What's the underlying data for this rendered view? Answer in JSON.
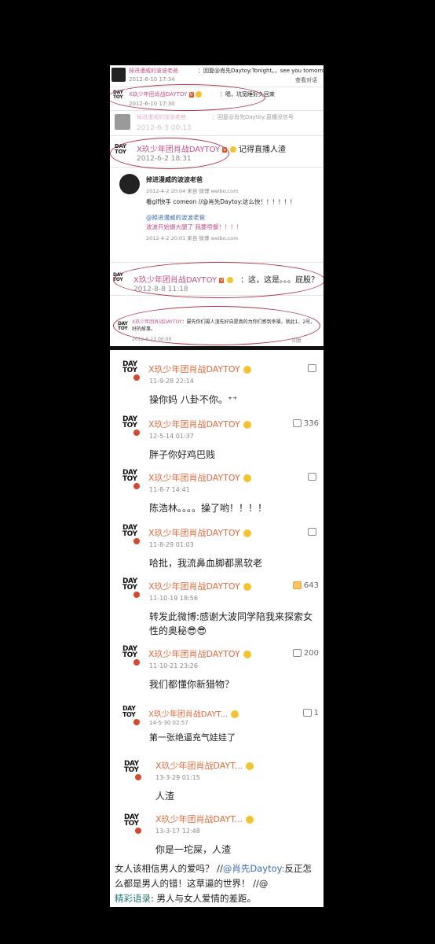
{
  "archive": {
    "rows": [
      {
        "name": "掉进漫威的波波老爸",
        "text": "：回复@肖先Daytoy:Tonight。，see you tomorrom",
        "time": "2012-6-10 17:34",
        "action": "查看对话"
      },
      {
        "name": "X玖少年团肖战DAYTOY",
        "text": "：嗯，坑宽睡好久回来",
        "time": "2012-6-10 17:30"
      },
      {
        "name": "掉进漫威的波波老爸",
        "text": "：回复@肖先Daytoy:直播没信号",
        "time": "2012-6-3 00:13"
      },
      {
        "name": "X玖少年团肖战DAYTOY",
        "text": "记得直播人渣",
        "time": "2012-6-2 18:31"
      },
      {
        "name": "掉进漫威的波波老爸",
        "time": "2012-4-2 20:04 来自 微博 weibo.com",
        "text": "看gif快手 comeon //@肖先Daytoy:这么快！！！！！！"
      },
      {
        "name": "@掉进漫威的波波老爸",
        "text": "波波开始摄大腿了 我要喷餐！！！！",
        "time": "2012-4-2 20:01 来自 微博 weibo.com"
      },
      {
        "name": "X玖少年团肖战DAYTOY",
        "text": "：这，这是。。。屁股？",
        "time": "2012-8-8 11:18"
      },
      {
        "name": "X玖少年团肖战DAYTOY",
        "text": "：屡先你们摄人渣先好自是真的为你们感到幸福，就此1、2号，好的故事。",
        "time": "2012-6-23 00:09",
        "action": "回复"
      }
    ]
  },
  "comments": [
    {
      "name": "X玖少年团肖战DAYTOY",
      "time": "11-9-28 22:14",
      "text": "操你妈  八卦不你。⁺⁺",
      "likes": ""
    },
    {
      "name": "X玖少年团肖战DAYTOY",
      "time": "12-5-14 01:37",
      "text": "胖子你好鸡巴贱",
      "likes": "336"
    },
    {
      "name": "X玖少年团肖战DAYTOY",
      "time": "11-8-7 14:41",
      "text": "陈浩林。。。。操了哟！！！！",
      "likes": ""
    },
    {
      "name": "X玖少年团肖战DAYTOY",
      "time": "11-8-29 01:03",
      "text": "哈批，我流鼻血脚都黑软老",
      "likes": ""
    },
    {
      "name": "X玖少年团肖战DAYTOY",
      "time": "11-10-19 18:56",
      "text": "转发此微博:感谢大波同学陪我来探索女性的奥秘😎😎",
      "likes": "643"
    },
    {
      "name": "X玖少年团肖战DAYTOY",
      "time": "11-10-21 23:26",
      "text": "我们都懂你新猎物？",
      "likes": "200"
    },
    {
      "name": "X玖少年团肖战DAYT...",
      "time": "14-5-30 02:57",
      "text": "第一张绝逼充气娃娃了",
      "likes": "1"
    },
    {
      "name": "X玖少年团肖战DAYT...",
      "time": "13-3-29 01:15",
      "text": "人渣",
      "likes": ""
    },
    {
      "name": "X玖少年团肖战DAYT...",
      "time": "13-3-17 12:48",
      "text": "你是一坨屎，人渣",
      "likes": ""
    }
  ],
  "footer": {
    "line1a": "女人该相信男人的爱吗？ //",
    "line1b": "@肖先Daytoy:",
    "line1c": "反正怎么都是男人的错！这草逼的世界！ //@",
    "line2a": "精彩语录",
    "line2b": ": 男人与女人爱情的差距。"
  },
  "logo_text": "DAY TOY"
}
